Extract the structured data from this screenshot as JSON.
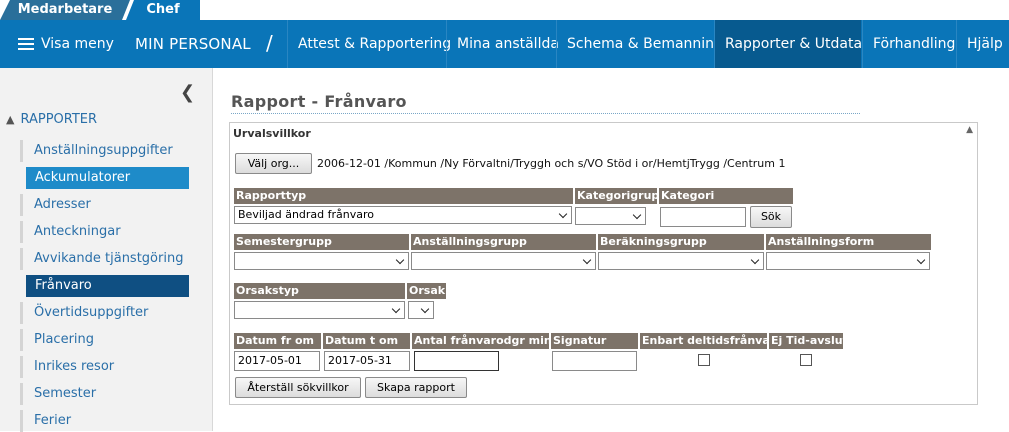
{
  "tabs": {
    "employee": "Medarbetare",
    "chef": "Chef"
  },
  "nav": {
    "menu_label": "Visa meny",
    "brand": "MIN PERSONAL",
    "separator": "/",
    "items": [
      "Attest & Rapportering",
      "Mina anställda",
      "Schema & Bemanning",
      "Rapporter & Utdata",
      "Förhandling",
      "Hjälp"
    ],
    "active_index": 3
  },
  "sidebar": {
    "section": "RAPPORTER",
    "items": [
      "Anställningsuppgifter",
      "Ackumulatorer",
      "Adresser",
      "Anteckningar",
      "Avvikande tjänstgöring",
      "Frånvaro",
      "Övertidsuppgifter",
      "Placering",
      "Inrikes resor",
      "Semester",
      "Ferier"
    ]
  },
  "page": {
    "title": "Rapport - Frånvaro"
  },
  "panel": {
    "title": "Urvalsvillkor",
    "org_button": "Välj org...",
    "org_path": "2006-12-01 /Kommun /Ny Förvaltni/Tryggh och s/VO Stöd i or/HemtjTrygg /Centrum 1",
    "labels": {
      "rapporttyp": "Rapporttyp",
      "kategorigrupp": "Kategorigrupp",
      "kategori": "Kategori",
      "semestergrupp": "Semestergrupp",
      "anstallningsgrupp": "Anställningsgrupp",
      "berakningsgrupp": "Beräkningsgrupp",
      "anstallningsform": "Anställningsform",
      "orsakstyp": "Orsakstyp",
      "orsak": "Orsak",
      "datum_from": "Datum fr om",
      "datum_tom": "Datum t om",
      "antal": "Antal frånvarodgr minst",
      "signatur": "Signatur",
      "deltid": "Enbart deltidsfrånvaro",
      "ej_tid": "Ej Tid-avslut"
    },
    "values": {
      "rapporttyp": "Beviljad ändrad frånvaro",
      "datum_from": "2017-05-01",
      "datum_tom": "2017-05-31"
    },
    "search_button": "Sök",
    "reset_button": "Återställ sökvillkor",
    "create_button": "Skapa rapport"
  }
}
